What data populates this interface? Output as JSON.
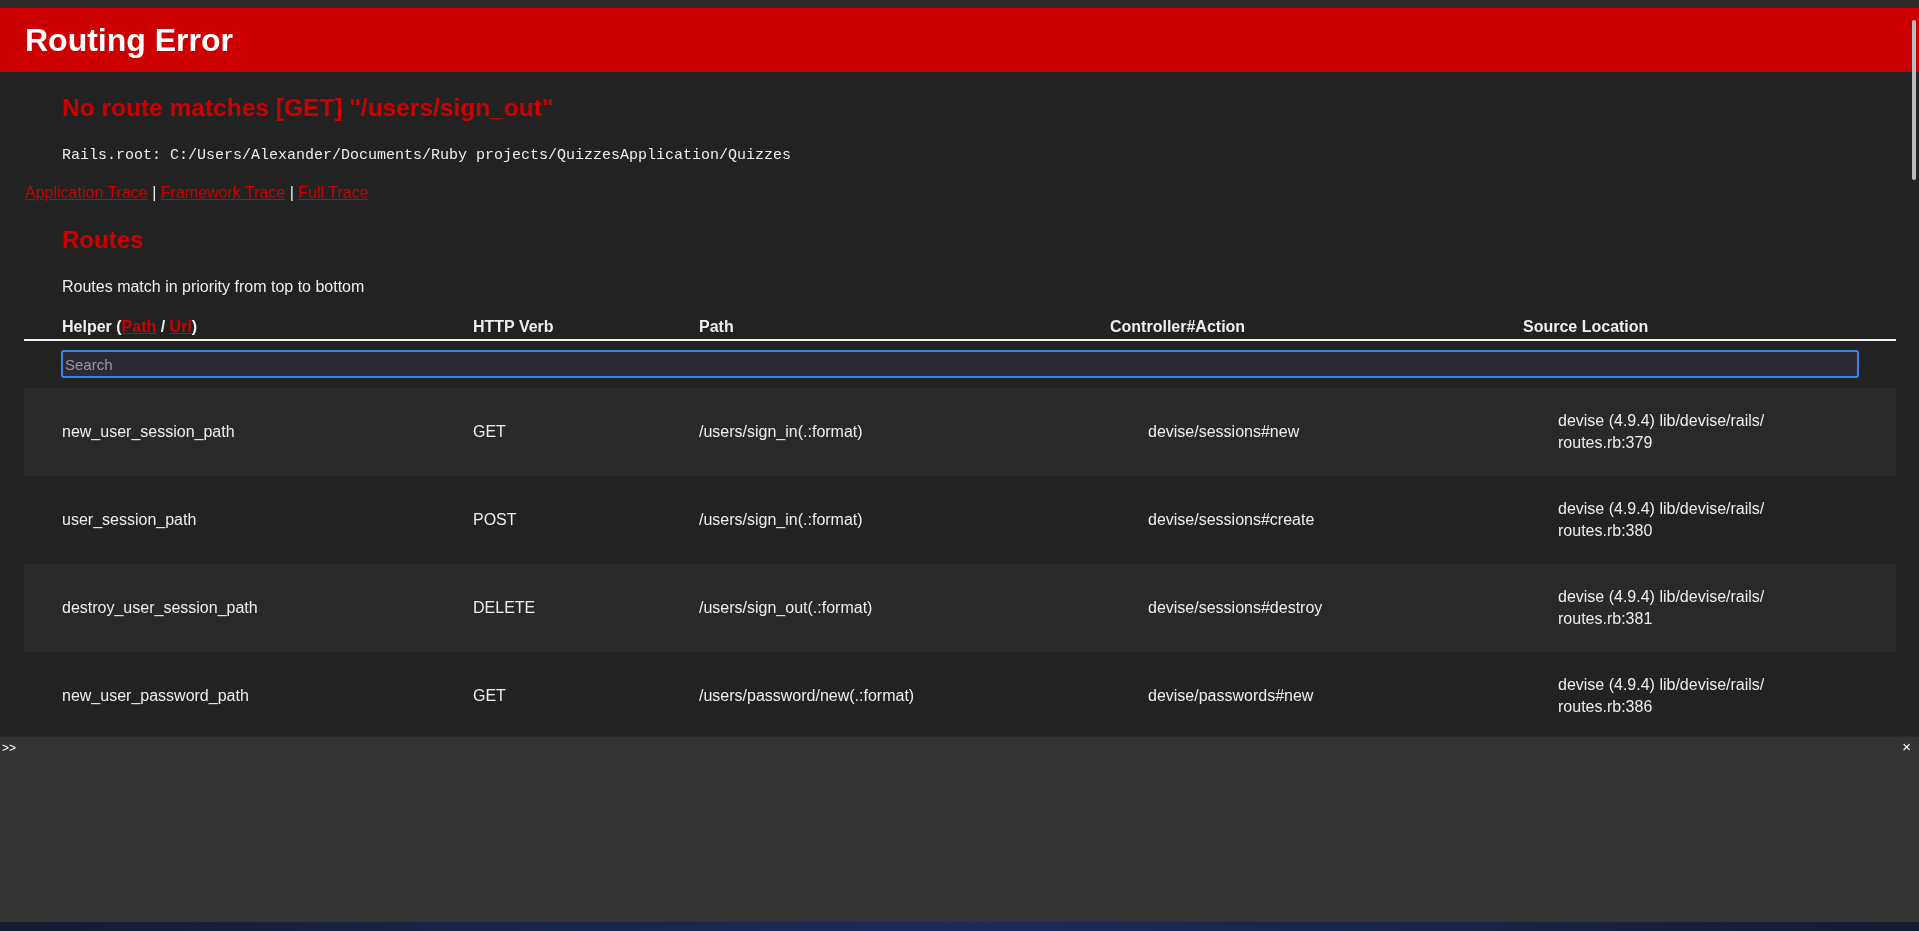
{
  "header": {
    "title": "Routing Error"
  },
  "error": {
    "message": "No route matches [GET] \"/users/sign_out\"",
    "rails_root": "Rails.root: C:/Users/Alexander/Documents/Ruby projects/QuizzesApplication/Quizzes"
  },
  "trace_links": {
    "separator": "|",
    "links": [
      "Application Trace",
      "Framework Trace",
      "Full Trace"
    ]
  },
  "routes": {
    "heading": "Routes",
    "description": "Routes match in priority from top to bottom",
    "columns": [
      {
        "parts": [
          {
            "kind": "text",
            "text": "Helper ("
          },
          {
            "kind": "link",
            "text": "Path"
          },
          {
            "kind": "text",
            "text": " / "
          },
          {
            "kind": "link",
            "text": "Url"
          },
          {
            "kind": "text",
            "text": ")"
          }
        ]
      },
      {
        "parts": [
          {
            "kind": "text",
            "text": "HTTP Verb"
          }
        ]
      },
      {
        "parts": [
          {
            "kind": "text",
            "text": "Path"
          }
        ]
      },
      {
        "parts": [
          {
            "kind": "text",
            "text": "Controller#Action"
          }
        ]
      },
      {
        "parts": [
          {
            "kind": "text",
            "text": "Source Location"
          }
        ]
      }
    ],
    "search": {
      "placeholder": "Search"
    },
    "rows": [
      {
        "helper": "new_user_session_path",
        "verb": "GET",
        "path": "/users/sign_in(.:format)",
        "action": "devise/sessions#new",
        "source": [
          "devise (4.9.4) lib/devise/rails/",
          "routes.rb:379"
        ]
      },
      {
        "helper": "user_session_path",
        "verb": "POST",
        "path": "/users/sign_in(.:format)",
        "action": "devise/sessions#create",
        "source": [
          "devise (4.9.4) lib/devise/rails/",
          "routes.rb:380"
        ]
      },
      {
        "helper": "destroy_user_session_path",
        "verb": "DELETE",
        "path": "/users/sign_out(.:format)",
        "action": "devise/sessions#destroy",
        "source": [
          "devise (4.9.4) lib/devise/rails/",
          "routes.rb:381"
        ]
      },
      {
        "helper": "new_user_password_path",
        "verb": "GET",
        "path": "/users/password/new(.:format)",
        "action": "devise/passwords#new",
        "source": [
          "devise (4.9.4) lib/devise/rails/",
          "routes.rb:386"
        ]
      }
    ]
  },
  "console": {
    "prompt": ">>",
    "close": "×"
  }
}
